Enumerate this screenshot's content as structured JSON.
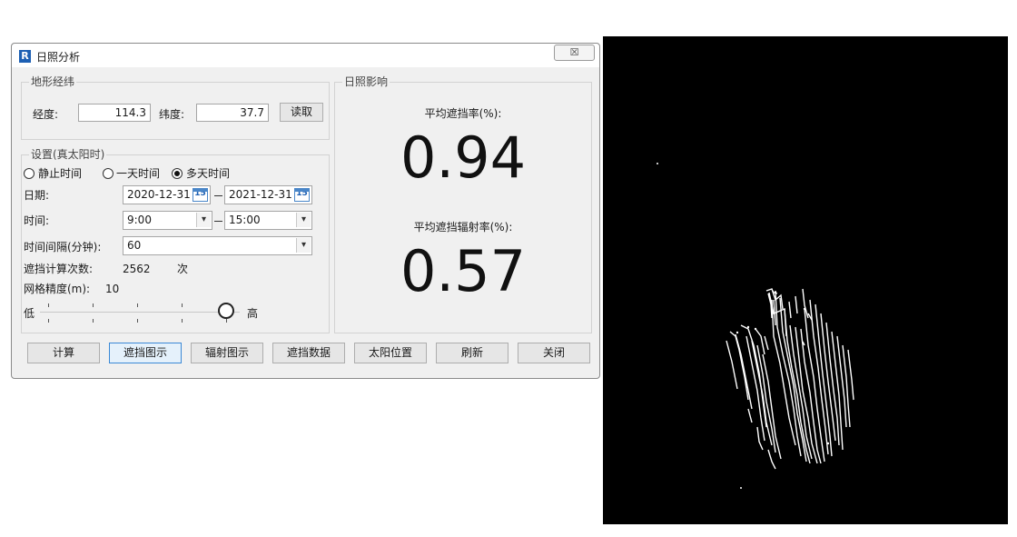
{
  "window": {
    "title": "日照分析",
    "app_icon": "R",
    "close_glyph": "☒"
  },
  "terrain": {
    "group_title": "地形经纬",
    "lon_label": "经度:",
    "lon_value": "114.3",
    "lat_label": "纬度:",
    "lat_value": "37.7",
    "read_button": "读取"
  },
  "settings": {
    "group_title": "设置(真太阳时)",
    "modes": [
      {
        "label": "静止时间",
        "selected": false
      },
      {
        "label": "一天时间",
        "selected": false
      },
      {
        "label": "多天时间",
        "selected": true
      }
    ],
    "date_label": "日期:",
    "date_from": "2020-12-31",
    "date_to": "2021-12-31",
    "cal_icon_text": "15",
    "time_label": "时间:",
    "time_from": "9:00",
    "time_to": "15:00",
    "interval_label": "时间间隔(分钟):",
    "interval_value": "60",
    "count_label": "遮挡计算次数:",
    "count_value": "2562",
    "count_unit": "次",
    "grid_label": "网格精度(m):",
    "grid_value": "10",
    "slider_low": "低",
    "slider_high": "高",
    "slider_level": 1.0
  },
  "impact": {
    "group_title": "日照影响",
    "avg_shading_label": "平均遮挡率(%):",
    "avg_shading_value": "0.94",
    "avg_radiation_label": "平均遮挡辐射率(%):",
    "avg_radiation_value": "0.57"
  },
  "buttons": {
    "calc": "计算",
    "shade_map": "遮挡图示",
    "rad_map": "辐射图示",
    "shade_data": "遮挡数据",
    "sun_pos": "太阳位置",
    "refresh": "刷新",
    "close": "关闭"
  },
  "colors": {
    "viewport_bg": "#000000",
    "accent": "#1c5fb3",
    "focus_border": "#3b88d6"
  }
}
